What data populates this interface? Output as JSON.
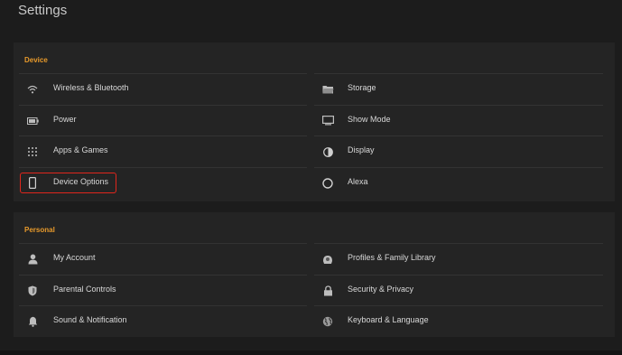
{
  "header": {
    "title": "Settings"
  },
  "device": {
    "title": "Device",
    "left": [
      {
        "label": "Wireless & Bluetooth",
        "icon": "wifi-icon"
      },
      {
        "label": "Power",
        "icon": "battery-icon"
      },
      {
        "label": "Apps & Games",
        "icon": "grid-icon"
      },
      {
        "label": "Device Options",
        "icon": "tablet-icon",
        "highlighted": true
      }
    ],
    "right": [
      {
        "label": "Storage",
        "icon": "folder-icon"
      },
      {
        "label": "Show Mode",
        "icon": "monitor-icon"
      },
      {
        "label": "Display",
        "icon": "contrast-icon"
      },
      {
        "label": "Alexa",
        "icon": "alexa-ring-icon"
      }
    ]
  },
  "personal": {
    "title": "Personal",
    "left": [
      {
        "label": "My Account",
        "icon": "person-icon"
      },
      {
        "label": "Parental Controls",
        "icon": "shield-icon"
      },
      {
        "label": "Sound & Notification",
        "icon": "bell-icon"
      }
    ],
    "right": [
      {
        "label": "Profiles & Family Library",
        "icon": "profiles-icon"
      },
      {
        "label": "Security & Privacy",
        "icon": "lock-icon"
      },
      {
        "label": "Keyboard & Language",
        "icon": "globe-icon"
      }
    ]
  },
  "colors": {
    "section_header": "#e89a2b",
    "highlight": "#e0261c",
    "background": "#1c1c1c",
    "panel": "#242424"
  }
}
